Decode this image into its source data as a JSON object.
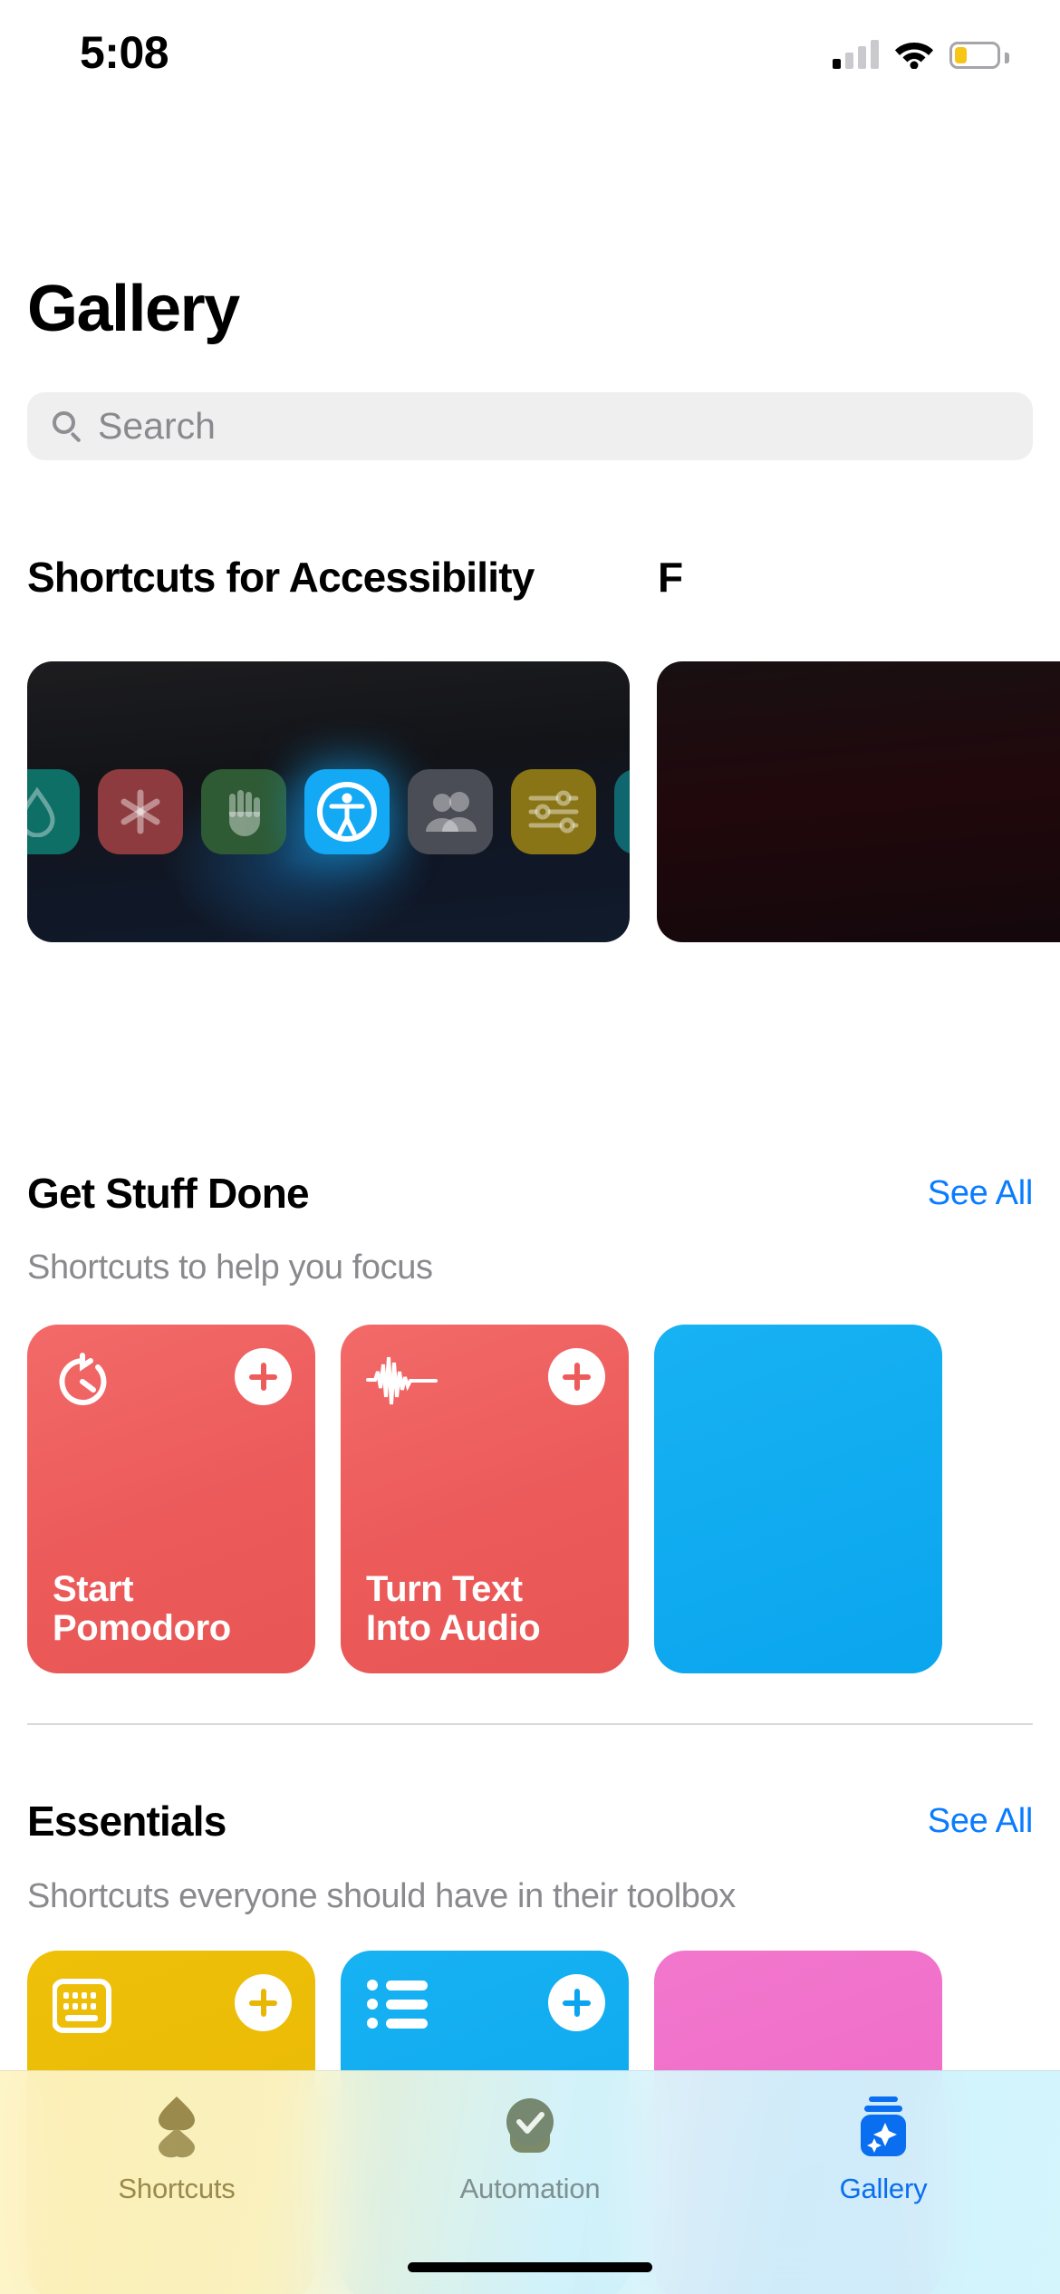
{
  "status_bar": {
    "time": "5:08",
    "cellular_icon": "cellular-signal-icon",
    "cellular_bars_filled": 1,
    "wifi_icon": "wifi-icon",
    "battery_icon": "battery-low-icon",
    "battery_color": "#F5C518"
  },
  "header": {
    "title": "Gallery"
  },
  "search": {
    "placeholder": "Search",
    "value": "",
    "icon": "search-icon",
    "background": "#EFEFF0"
  },
  "accent_color": "#0A7CFF",
  "sections": [
    {
      "id": "accessibility",
      "title": "Shortcuts for Accessibility",
      "subtitle": "",
      "see_all": "",
      "type": "banner",
      "banner_icons": [
        {
          "name": "drop-icon",
          "color": "#0E6F66",
          "glyph": "drop"
        },
        {
          "name": "medical-asterisk-icon",
          "color": "#8D3B3F",
          "glyph": "asterisk"
        },
        {
          "name": "hand-raised-icon",
          "color": "#2F5B34",
          "glyph": "hand"
        },
        {
          "name": "accessibility-icon",
          "color": "#14A9F5",
          "glyph": "accessibility"
        },
        {
          "name": "people-icon",
          "color": "#4A4D55",
          "glyph": "people"
        },
        {
          "name": "sliders-icon",
          "color": "#8A7516",
          "glyph": "sliders"
        },
        {
          "name": "sparkle-icon",
          "color": "#10666E",
          "glyph": "sparkle"
        }
      ],
      "next_banner_peek_title": "F"
    },
    {
      "id": "get-stuff-done",
      "title": "Get Stuff Done",
      "subtitle": "Shortcuts to help you focus",
      "see_all": "See All",
      "type": "cards",
      "cards": [
        {
          "label": "Start Pomodoro",
          "color": "#ED5B5B",
          "style": "red-card",
          "icon": "timer-icon",
          "add": "add-icon"
        },
        {
          "label": "Turn Text\nInto Audio",
          "color": "#ED5B5B",
          "style": "red-card",
          "icon": "waveform-icon",
          "add": "add-icon"
        },
        {
          "label": "",
          "color": "#0AA5EE",
          "style": "blue-card",
          "icon": "",
          "add": ""
        }
      ]
    },
    {
      "id": "essentials",
      "title": "Essentials",
      "subtitle": "Shortcuts everyone should have in their toolbox",
      "see_all": "See All",
      "type": "cards",
      "cards": [
        {
          "label": "",
          "color": "#E8B706",
          "style": "gold-card",
          "icon": "keyboard-icon",
          "add": "add-icon"
        },
        {
          "label": "",
          "color": "#0AA5EE",
          "style": "blue-card",
          "icon": "list-icon",
          "add": "add-icon"
        },
        {
          "label": "",
          "color": "#EE66C4",
          "style": "pink-card",
          "icon": "",
          "add": ""
        }
      ]
    }
  ],
  "tab_bar": {
    "items": [
      {
        "id": "shortcuts",
        "label": "Shortcuts",
        "icon": "shortcuts-icon",
        "active": false
      },
      {
        "id": "automation",
        "label": "Automation",
        "icon": "automation-icon",
        "active": false
      },
      {
        "id": "gallery",
        "label": "Gallery",
        "icon": "gallery-icon",
        "active": true
      }
    ],
    "active": "gallery"
  }
}
